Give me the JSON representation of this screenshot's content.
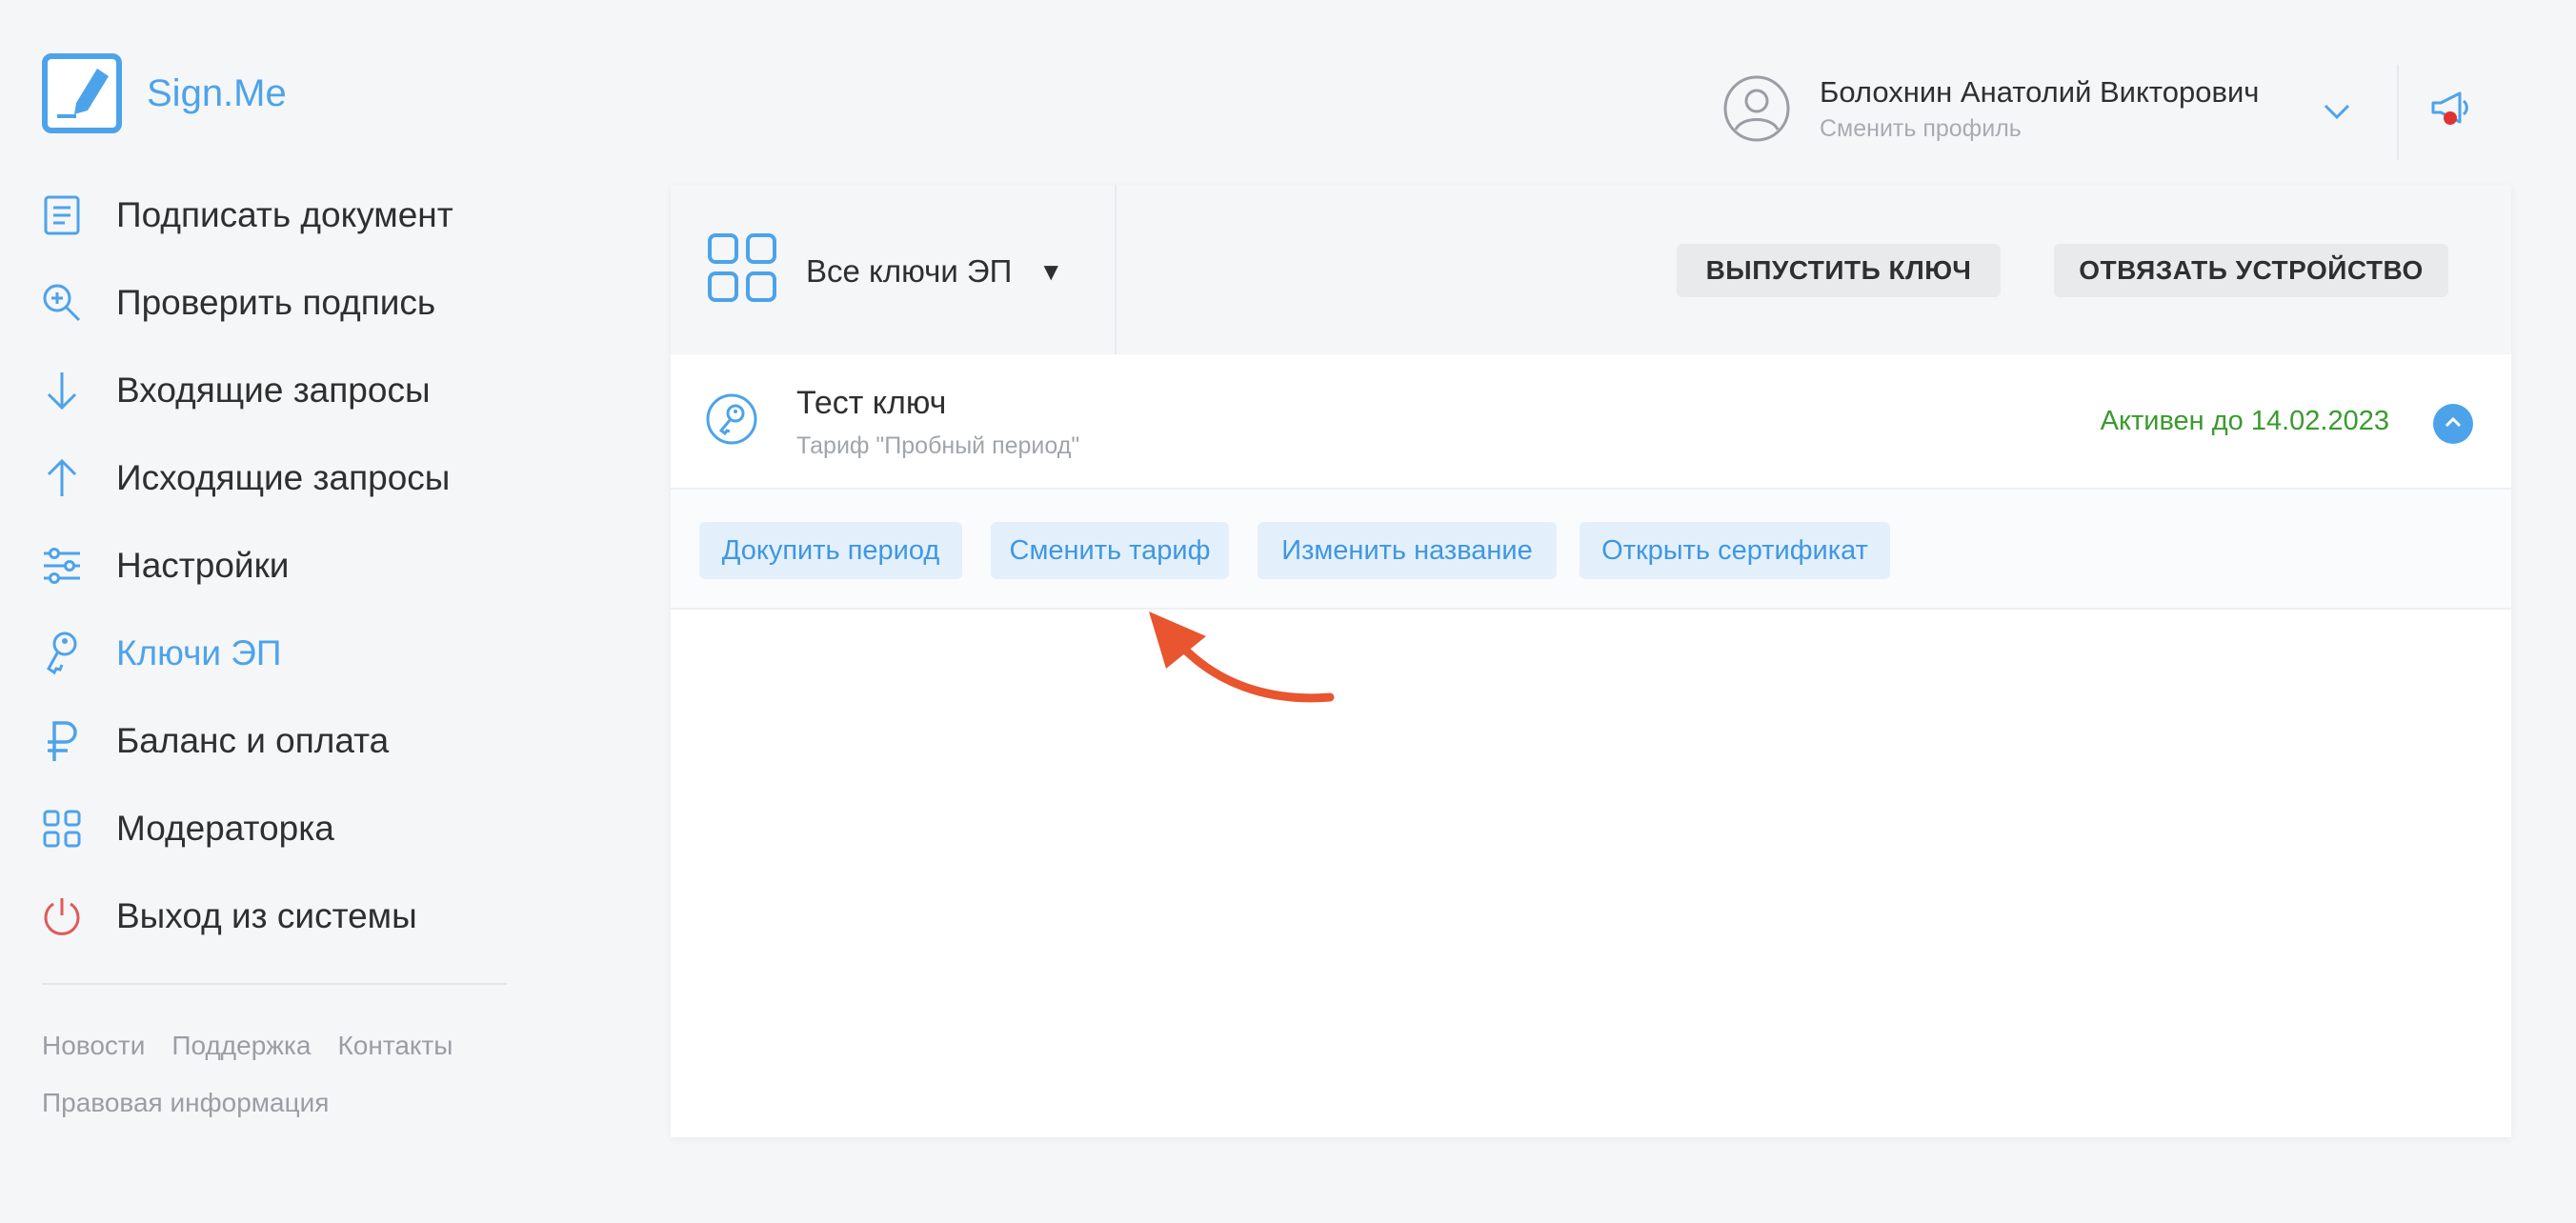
{
  "app": {
    "brand": "Sign.Me"
  },
  "sidebar": {
    "items": [
      {
        "label": "Подписать документ",
        "icon": "document-icon"
      },
      {
        "label": "Проверить подпись",
        "icon": "magnifier-plus-icon"
      },
      {
        "label": "Входящие запросы",
        "icon": "arrow-down-icon"
      },
      {
        "label": "Исходящие запросы",
        "icon": "arrow-up-icon"
      },
      {
        "label": "Настройки",
        "icon": "sliders-icon"
      },
      {
        "label": "Ключи ЭП",
        "icon": "key-icon",
        "active": true
      },
      {
        "label": "Баланс и оплата",
        "icon": "ruble-icon"
      },
      {
        "label": "Модераторка",
        "icon": "grid-icon"
      },
      {
        "label": "Выход из системы",
        "icon": "power-icon"
      }
    ],
    "footer": {
      "links": [
        "Новости",
        "Поддержка",
        "Контакты"
      ],
      "legal": "Правовая информация"
    }
  },
  "header": {
    "user_name": "Болохнин Анатолий Викторович",
    "switch_profile": "Сменить профиль"
  },
  "toolbar": {
    "filter_label": "Все ключи ЭП",
    "filter_caret": "▼",
    "issue_key": "ВЫПУСТИТЬ КЛЮЧ",
    "unbind_device": "ОТВЯЗАТЬ УСТРОЙСТВО"
  },
  "key": {
    "name": "Тест ключ",
    "tariff": "Тариф \"Пробный период\"",
    "status": "Активен до 14.02.2023",
    "actions": [
      "Докупить период",
      "Сменить тариф",
      "Изменить название",
      "Открыть сертификат"
    ]
  },
  "colors": {
    "accent": "#4da3ea",
    "active_status": "#3a9a2e",
    "logout_icon": "#e05a5a",
    "annotation_arrow": "#e8552e",
    "background": "#f5f6f8"
  }
}
